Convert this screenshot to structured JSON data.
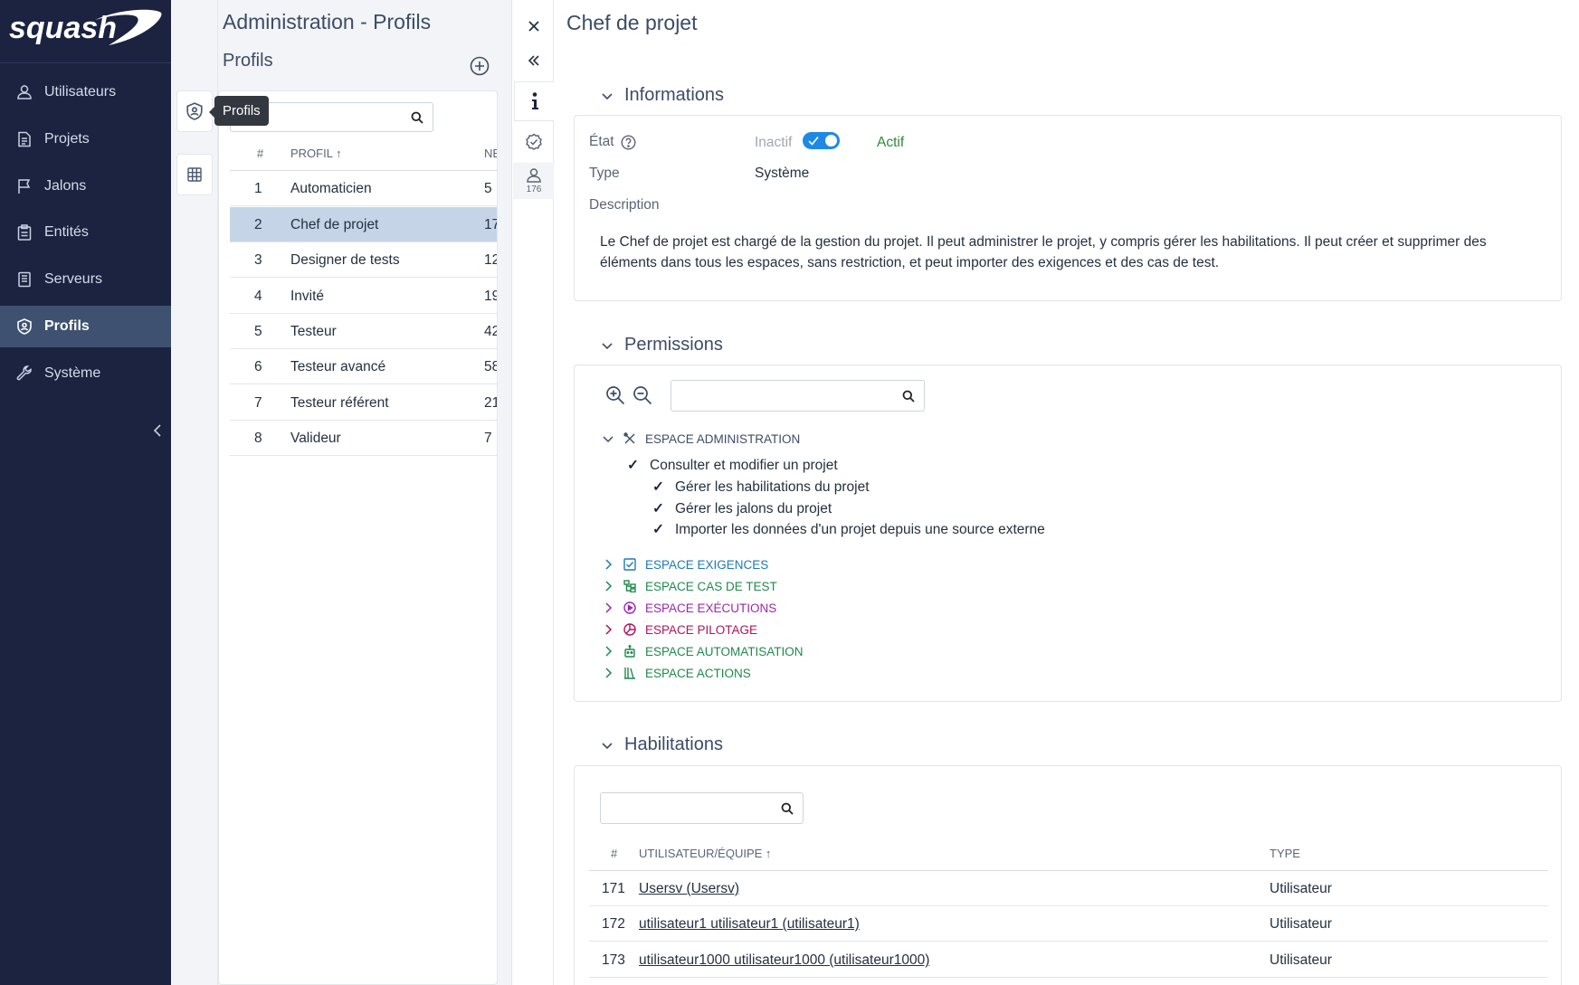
{
  "app": {
    "logo_text": "squash"
  },
  "nav": {
    "items": [
      {
        "label": "Utilisateurs",
        "icon": "user-icon"
      },
      {
        "label": "Projets",
        "icon": "document-icon"
      },
      {
        "label": "Jalons",
        "icon": "flag-icon"
      },
      {
        "label": "Entités",
        "icon": "clipboard-icon"
      },
      {
        "label": "Serveurs",
        "icon": "server-icon"
      },
      {
        "label": "Profils",
        "icon": "shield-user-icon",
        "active": true
      },
      {
        "label": "Système",
        "icon": "wrench-icon"
      }
    ]
  },
  "strip": {
    "tooltip": "Profils"
  },
  "list": {
    "admin_title": "Administration - Profils",
    "title": "Profils",
    "search_placeholder": "",
    "columns": {
      "num": "#",
      "profile": "PROFIL",
      "nb": "NE"
    },
    "rows": [
      {
        "num": "1",
        "name": "Automaticien",
        "nb": "5"
      },
      {
        "num": "2",
        "name": "Chef de projet",
        "nb": "17",
        "selected": true
      },
      {
        "num": "3",
        "name": "Designer de tests",
        "nb": "12"
      },
      {
        "num": "4",
        "name": "Invité",
        "nb": "19"
      },
      {
        "num": "5",
        "name": "Testeur",
        "nb": "42"
      },
      {
        "num": "6",
        "name": "Testeur avancé",
        "nb": "58"
      },
      {
        "num": "7",
        "name": "Testeur référent",
        "nb": "21"
      },
      {
        "num": "8",
        "name": "Valideur",
        "nb": "7"
      }
    ]
  },
  "detail_strip": {
    "user_count": "176"
  },
  "detail": {
    "title": "Chef de projet",
    "informations": {
      "heading": "Informations",
      "state_label": "État",
      "state_off": "Inactif",
      "state_on": "Actif",
      "active": true,
      "type_label": "Type",
      "type_value": "Système",
      "description_label": "Description",
      "description": "Le Chef de projet est chargé de la gestion du projet. Il peut administrer le projet, y compris gérer les habilitations. Il peut créer et supprimer des éléments dans tous les espaces, sans restriction, et peut importer des exigences et des cas de test."
    },
    "permissions": {
      "heading": "Permissions",
      "search_placeholder": "",
      "admin_space": {
        "label": "ESPACE ADMINISTRATION",
        "parent": "Consulter et modifier un projet",
        "children": [
          "Gérer les habilitations du projet",
          "Gérer les jalons du projet",
          "Importer les données d'un projet depuis une source externe"
        ]
      },
      "spaces": [
        {
          "label": "ESPACE EXIGENCES",
          "color": "#1d7ab5",
          "icon": "checkbox-icon"
        },
        {
          "label": "ESPACE CAS DE TEST",
          "color": "#1f8a4c",
          "icon": "tree-icon"
        },
        {
          "label": "ESPACE EXÉCUTIONS",
          "color": "#9b27af",
          "icon": "play-circle-icon"
        },
        {
          "label": "ESPACE PILOTAGE",
          "color": "#b0145c",
          "icon": "pie-chart-icon"
        },
        {
          "label": "ESPACE AUTOMATISATION",
          "color": "#1f8a4c",
          "icon": "robot-icon"
        },
        {
          "label": "ESPACE ACTIONS",
          "color": "#1f8a4c",
          "icon": "library-icon"
        }
      ]
    },
    "habilitations": {
      "heading": "Habilitations",
      "search_placeholder": "",
      "columns": {
        "num": "#",
        "user": "UTILISATEUR/ÉQUIPE",
        "type": "TYPE"
      },
      "rows": [
        {
          "num": "171",
          "user": "Usersv (Usersv)",
          "type": "Utilisateur"
        },
        {
          "num": "172",
          "user": "utilisateur1 utilisateur1 (utilisateur1)",
          "type": "Utilisateur"
        },
        {
          "num": "173",
          "user": "utilisateur1000 utilisateur1000 (utilisateur1000)",
          "type": "Utilisateur"
        }
      ]
    }
  }
}
